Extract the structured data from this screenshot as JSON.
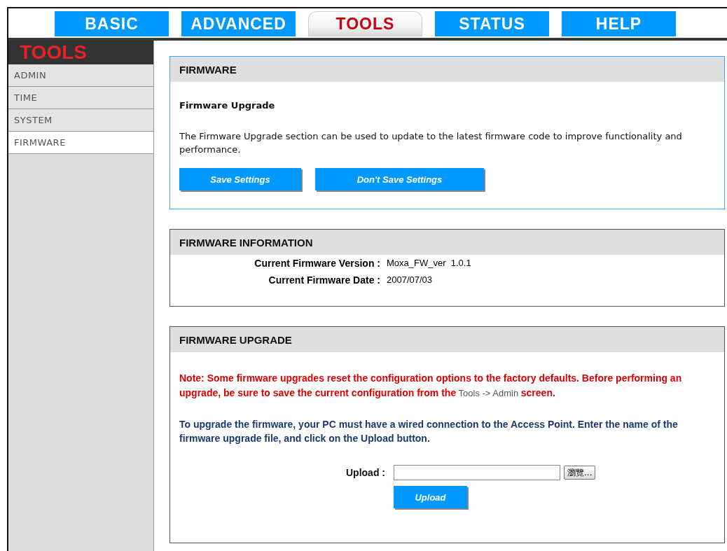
{
  "tabs": [
    {
      "label": "BASIC",
      "selected": false
    },
    {
      "label": "ADVANCED",
      "selected": false
    },
    {
      "label": "TOOLS",
      "selected": true
    },
    {
      "label": "STATUS",
      "selected": false
    },
    {
      "label": "HELP",
      "selected": false
    }
  ],
  "sidebar": {
    "title": "TOOLS",
    "items": [
      {
        "label": "ADMIN",
        "selected": false
      },
      {
        "label": "TIME",
        "selected": false
      },
      {
        "label": "SYSTEM",
        "selected": false
      },
      {
        "label": "FIRMWARE",
        "selected": true
      }
    ]
  },
  "firmware": {
    "title": "FIRMWARE",
    "subtitle": "Firmware Upgrade",
    "description": "The Firmware Upgrade section can be used to update to the latest firmware code to improve functionality and performance.",
    "buttons": [
      "Save Settings",
      "Don't Save Settings"
    ]
  },
  "firmware_information": {
    "title": "FIRMWARE INFORMATION",
    "rows": [
      {
        "label": "Current Firmware Version :",
        "value": "Moxa_FW_ver  1.0.1"
      },
      {
        "label": "Current Firmware Date :",
        "value": "2007/07/03"
      }
    ]
  },
  "firmware_upgrade": {
    "title": "FIRMWARE UPGRADE",
    "note": "**Note: Some firmware upgrades reset the configuration options to the factory defaults. Before performing an upgrade, be sure to save the current configuration from the** Tools -> Admin **screen.**",
    "instructions": "To upgrade the firmware, your PC must have a wired connection to the Access Point. Enter the name of the firmware upgrade file, and click on the Upload button.",
    "upload": {
      "label": "Upload :",
      "browse_button": "瀏覽...",
      "button": "Upload"
    }
  }
}
